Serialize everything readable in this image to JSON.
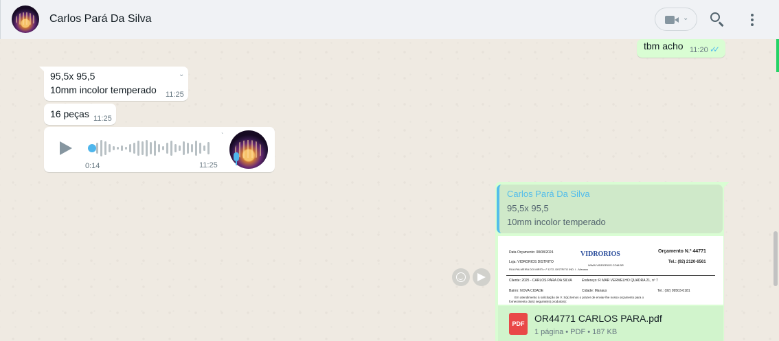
{
  "header": {
    "contact_name": "Carlos Pará Da Silva",
    "avatar_icon": "contact-avatar",
    "video_icon": "video-camera-icon",
    "video_caret": "⌄",
    "search_icon": "search-icon",
    "menu_icon": "kebab-menu-icon"
  },
  "messages": [
    {
      "direction": "out",
      "text": "tbm acho",
      "time": "11:20",
      "status": "read"
    },
    {
      "direction": "in",
      "lines": [
        "95,5x 95,5",
        "10mm incolor temperado"
      ],
      "time": "11:25"
    },
    {
      "direction": "in",
      "text": "16 peças",
      "time": "11:25"
    },
    {
      "direction": "in",
      "type": "voice",
      "duration": "0:14",
      "time": "11:25"
    },
    {
      "direction": "out",
      "type": "document",
      "quote": {
        "author": "Carlos Pará Da Silva",
        "lines": [
          "95,5x 95,5",
          "10mm incolor temperado"
        ]
      },
      "file_name": "OR44771 CARLOS PARA.pdf",
      "file_icon": "PDF",
      "file_meta": "1 página • PDF • 187 KB"
    }
  ],
  "doc_preview": {
    "date": "Data Orçamento: 08/08/2024",
    "brand": "VIDRORIOS",
    "orcamento": "Orçamento N.º 44771",
    "loja": "Loja: VIDRORIOS DISTRITO",
    "site": "WWW.VIDRORIOS.COM.BR",
    "tel": "Tel.: (92) 2120-6561",
    "rua": "RUA PALMEIRA DO MIRITI n.º 1272, DISTRITO IND. I - Manaus",
    "cliente": "Cliente: 2025 - CARLOS PARA DA SILVA",
    "endereco": "Endereço: R MAR VERMELHO QUADRA 21, nº 7",
    "bairro": "Bairro: NOVA CIDADE",
    "cidade": "Cidade: Manaus",
    "tel_cliente": "Tel.: (92) 99503-0181",
    "atendimento": "Em atendimento à solicitação de V. S(a) temos o prazer de enviar-lhe nosso orçamento para o",
    "fornecimento": "fornecimento do(s) seguinte(s) produto(s):"
  },
  "colors": {
    "incoming": "#ffffff",
    "outgoing": "#d9fdd3",
    "accent": "#53bdeb",
    "background": "#efeae2"
  },
  "actions": {
    "emoji_icon": "emoji-react-icon",
    "forward_icon": "forward-icon"
  }
}
